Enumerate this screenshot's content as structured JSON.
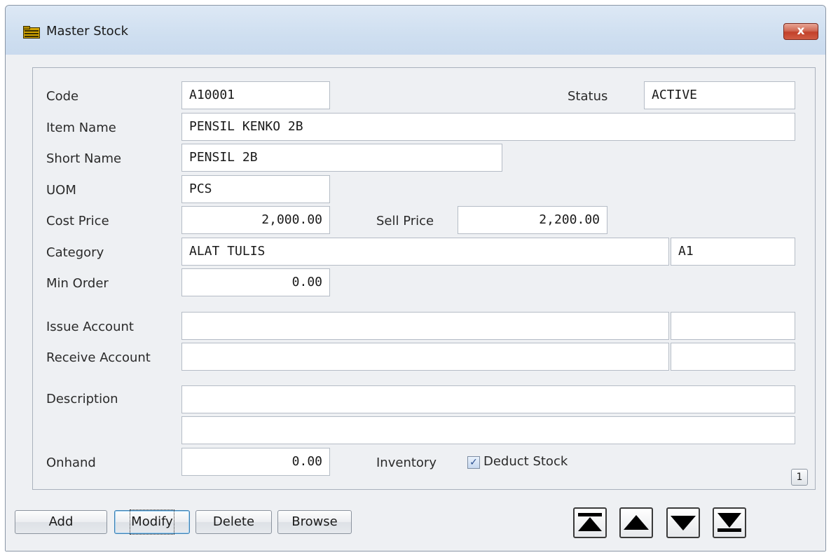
{
  "window": {
    "title": "Master Stock",
    "close_glyph": "x"
  },
  "form": {
    "code": {
      "label": "Code",
      "value": "A10001"
    },
    "status": {
      "label": "Status",
      "value": "ACTIVE"
    },
    "item_name": {
      "label": "Item Name",
      "value": "PENSIL KENKO 2B"
    },
    "short_name": {
      "label": "Short Name",
      "value": "PENSIL 2B"
    },
    "uom": {
      "label": "UOM",
      "value": "PCS"
    },
    "cost_price": {
      "label": "Cost Price",
      "value": "2,000.00"
    },
    "sell_price": {
      "label": "Sell Price",
      "value": "2,200.00"
    },
    "category": {
      "label": "Category",
      "value": "ALAT TULIS",
      "code": "A1"
    },
    "min_order": {
      "label": "Min Order",
      "value": "0.00"
    },
    "issue_account": {
      "label": "Issue Account",
      "value": "",
      "code": ""
    },
    "receive_account": {
      "label": "Receive Account",
      "value": "",
      "code": ""
    },
    "description": {
      "label": "Description",
      "line1": "",
      "line2": ""
    },
    "onhand": {
      "label": "Onhand",
      "value": "0.00"
    },
    "inventory": {
      "label": "Inventory",
      "deduct_label": "Deduct Stock",
      "deduct_checked": true
    }
  },
  "pager": {
    "page": "1"
  },
  "buttons": {
    "add": "Add",
    "modify": "Modify",
    "delete": "Delete",
    "browse": "Browse"
  },
  "nav_icons": [
    "first-record-icon",
    "previous-record-icon",
    "next-record-icon",
    "last-record-icon"
  ],
  "colors": {
    "close_button": "#c2412a",
    "title_bar": "#cfdff0",
    "window_bg": "#eef0f3",
    "field_bg": "#ffffff"
  }
}
